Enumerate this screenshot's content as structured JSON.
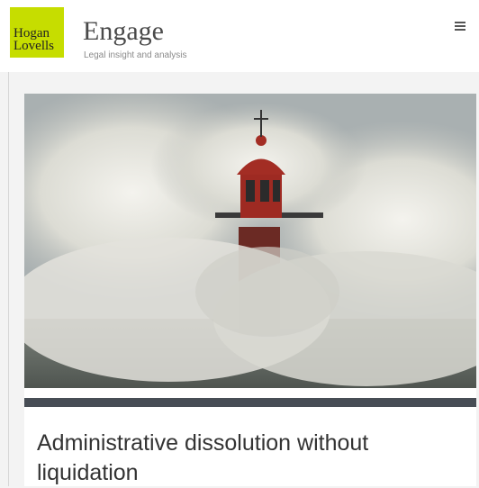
{
  "header": {
    "logo": {
      "line1": "Hogan",
      "line2": "Lovells",
      "color": "#c6dd00"
    },
    "title": "Engage",
    "subtitle": "Legal insight and analysis",
    "menu_icon": "hamburger-menu-icon"
  },
  "article": {
    "image": "lighthouse-in-storm-waves",
    "headline": "Administrative dissolution without liquidation",
    "accent_bar_color": "#474d55"
  }
}
